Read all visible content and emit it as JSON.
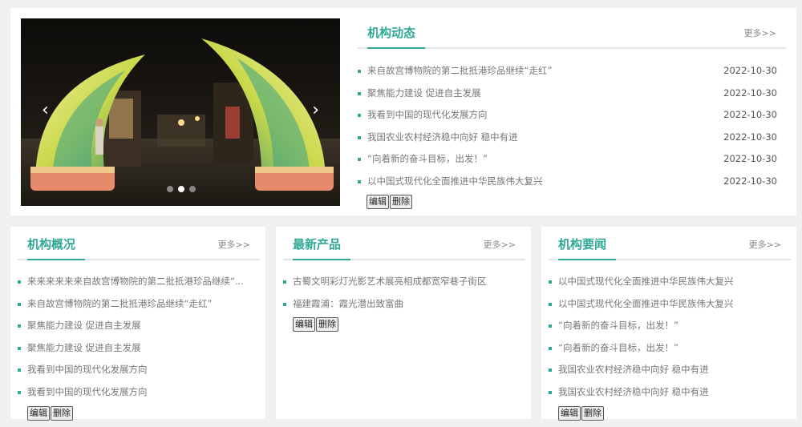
{
  "top": {
    "title": "机构动态",
    "more": "更多>>",
    "items": [
      {
        "title": "来自故宫博物院的第二批抵港珍品继续“走红”",
        "date": "2022-10-30"
      },
      {
        "title": "聚焦能力建设 促进自主发展",
        "date": "2022-10-30"
      },
      {
        "title": "我看到中国的现代化发展方向",
        "date": "2022-10-30"
      },
      {
        "title": "我国农业农村经济稳中向好 稳中有进",
        "date": "2022-10-30"
      },
      {
        "title": "“向着新的奋斗目标，出发！”",
        "date": "2022-10-30"
      },
      {
        "title": "以中国式现代化全面推进中华民族伟大复兴",
        "date": "2022-10-30"
      }
    ],
    "edit": "编辑",
    "delete": "删除"
  },
  "carousel": {
    "prev": "‹",
    "next": "›",
    "dot_count": 3,
    "active_dot": 2
  },
  "overview": {
    "title": "机构概况",
    "more": "更多>>",
    "items": [
      "来来来来来来自故宫博物院的第二批抵港珍品继续“...",
      "来自故宫博物院的第二批抵港珍品继续“走红”",
      "聚焦能力建设 促进自主发展",
      "聚焦能力建设 促进自主发展",
      "我看到中国的现代化发展方向",
      "我看到中国的现代化发展方向"
    ],
    "edit": "编辑",
    "delete": "删除"
  },
  "products": {
    "title": "最新产品",
    "more": "更多>>",
    "items": [
      "古蜀文明彩灯光影艺术展亮相成都宽窄巷子街区",
      "福建霞浦：霞光潜出致富曲"
    ],
    "edit": "编辑",
    "delete": "删除"
  },
  "news": {
    "title": "机构要闻",
    "more": "更多>>",
    "items": [
      "以中国式现代化全面推进中华民族伟大复兴",
      "以中国式现代化全面推进中华民族伟大复兴",
      "“向着新的奋斗目标，出发！”",
      "“向着新的奋斗目标，出发！”",
      "我国农业农村经济稳中向好 稳中有进",
      "我国农业农村经济稳中向好 稳中有进"
    ],
    "edit": "编辑",
    "delete": "删除"
  },
  "colors": {
    "accent": "#2fa896",
    "background": "#f0f0f0"
  }
}
